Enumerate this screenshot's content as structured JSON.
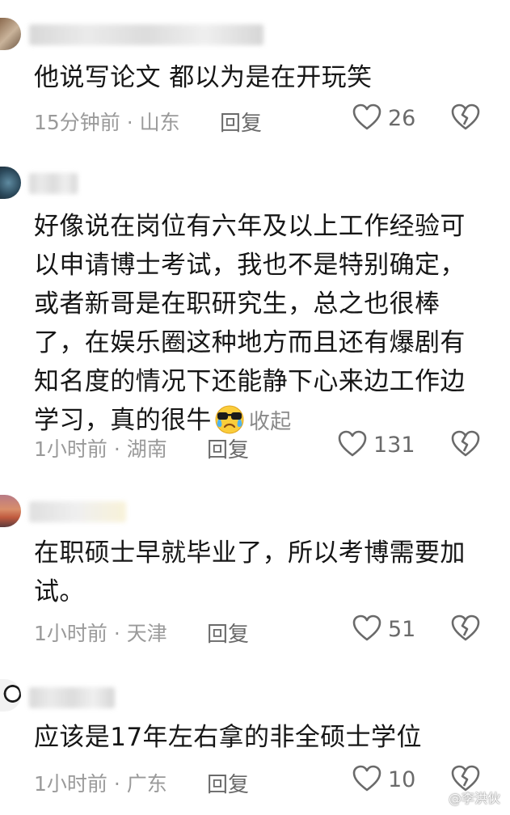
{
  "comments": [
    {
      "text": "他说写论文 都以为是在开玩笑",
      "time_location": "15分钟前 · 山东",
      "reply_label": "回复",
      "likes": "26",
      "collapse_label": ""
    },
    {
      "text": "好像说在岗位有六年及以上工作经验可以申请博士考试，我也不是特别确定，或者新哥是在职研究生，总之也很棒了，在娱乐圈这种地方而且还有爆剧有知名度的情况下还能静下心来边工作边学习，真的很牛",
      "time_location": "1小时前 · 湖南",
      "reply_label": "回复",
      "likes": "131",
      "collapse_label": "收起"
    },
    {
      "text": "在职硕士早就毕业了，所以考博需要加试。",
      "time_location": "1小时前 · 天津",
      "reply_label": "回复",
      "likes": "51",
      "collapse_label": ""
    },
    {
      "text": "应该是17年左右拿的非全硕士学位",
      "time_location": "1小时前 · 广东",
      "reply_label": "回复",
      "likes": "10",
      "collapse_label": ""
    }
  ],
  "icons": {
    "like": "heart-outline-icon",
    "dislike": "broken-heart-icon",
    "emoji": "crying-sunglasses-emoji"
  },
  "colors": {
    "text": "#161616",
    "meta": "#9a9a9a",
    "icon": "#6a6a6a"
  },
  "watermark": "@李洪伙"
}
